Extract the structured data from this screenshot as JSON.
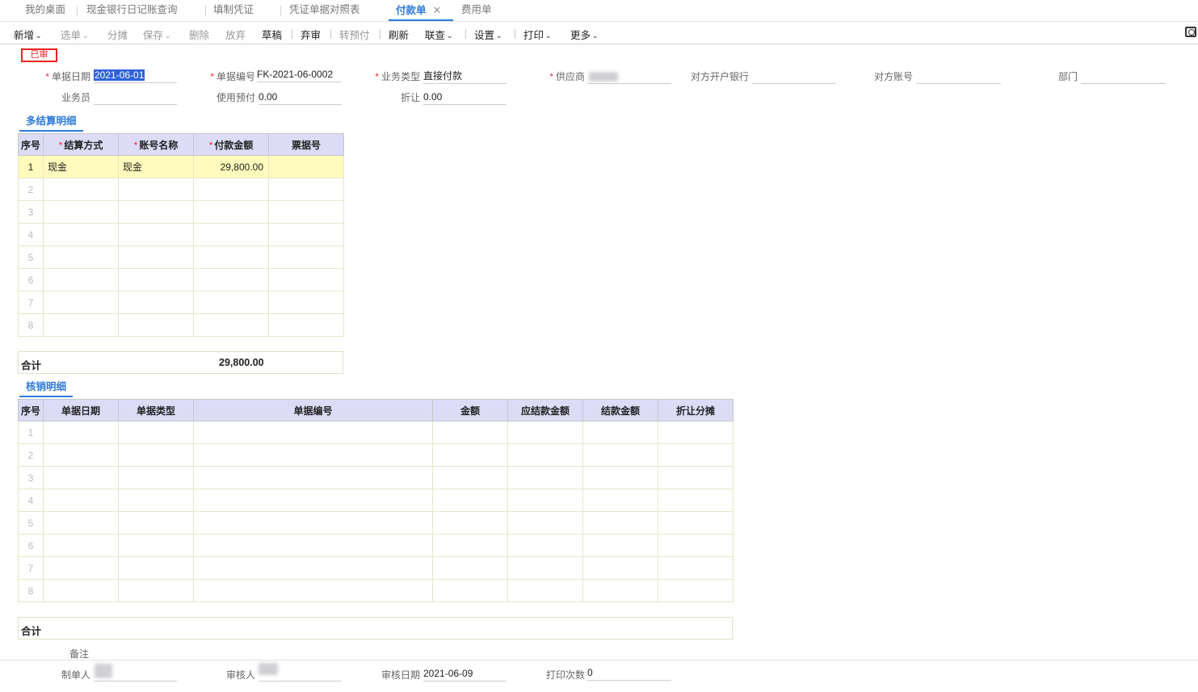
{
  "tabs": [
    {
      "label": "我的桌面"
    },
    {
      "label": "现金银行日记账查询"
    },
    {
      "label": "填制凭证"
    },
    {
      "label": "凭证单据对照表"
    },
    {
      "label": "付款单",
      "active": true
    },
    {
      "label": "费用单"
    }
  ],
  "toolbar": {
    "new": "新增",
    "select": "选单",
    "split": "分摊",
    "save": "保存",
    "delete": "删除",
    "discard": "放弃",
    "draft": "草稿",
    "unaudit": "弃审",
    "to_prepay": "转预付",
    "refresh": "刷新",
    "link_query": "联查",
    "settings": "设置",
    "print": "打印",
    "more": "更多",
    "caret": "⌄"
  },
  "status": "已审",
  "form": {
    "date_label": "单据日期",
    "date_value": "2021-06-01",
    "code_label": "单据编号",
    "code_value": "FK-2021-06-0002",
    "biztype_label": "业务类型",
    "biztype_value": "直接付款",
    "supplier_label": "供应商",
    "bank_label": "对方开户银行",
    "account_label": "对方账号",
    "dept_label": "部门",
    "clerk_label": "业务员",
    "prepay_label": "使用预付",
    "prepay_value": "0.00",
    "discount_label": "折让",
    "discount_value": "0.00"
  },
  "settle": {
    "tab_label": "多结算明细",
    "headers": [
      "序号",
      "结算方式",
      "账号名称",
      "付款金额",
      "票据号"
    ],
    "rows": [
      [
        "1",
        "现金",
        "现金",
        "29,800.00",
        ""
      ],
      [
        "2",
        "",
        "",
        "",
        ""
      ],
      [
        "3",
        "",
        "",
        "",
        ""
      ],
      [
        "4",
        "",
        "",
        "",
        ""
      ],
      [
        "5",
        "",
        "",
        "",
        ""
      ],
      [
        "6",
        "",
        "",
        "",
        ""
      ],
      [
        "7",
        "",
        "",
        "",
        ""
      ],
      [
        "8",
        "",
        "",
        "",
        ""
      ]
    ],
    "total_label": "合计",
    "total_value": "29,800.00"
  },
  "writeoff": {
    "tab_label": "核销明细",
    "headers": [
      "序号",
      "单据日期",
      "单据类型",
      "单据编号",
      "金额",
      "应结款金额",
      "结款金额",
      "折让分摊"
    ],
    "rows": [
      [
        "1"
      ],
      [
        "2"
      ],
      [
        "3"
      ],
      [
        "4"
      ],
      [
        "5"
      ],
      [
        "6"
      ],
      [
        "7"
      ],
      [
        "8"
      ]
    ],
    "total_label": "合计"
  },
  "footer": {
    "remark_label": "备注",
    "maker_label": "制单人",
    "auditor_label": "审核人",
    "audit_date_label": "审核日期",
    "audit_date_value": "2021-06-09",
    "print_count_label": "打印次数",
    "print_count_value": "0"
  },
  "colors": {
    "accent": "#2f7bd8",
    "stamp": "#e22222",
    "selected_row": "#fffbbd",
    "header_bg": "#dcdcf7"
  }
}
